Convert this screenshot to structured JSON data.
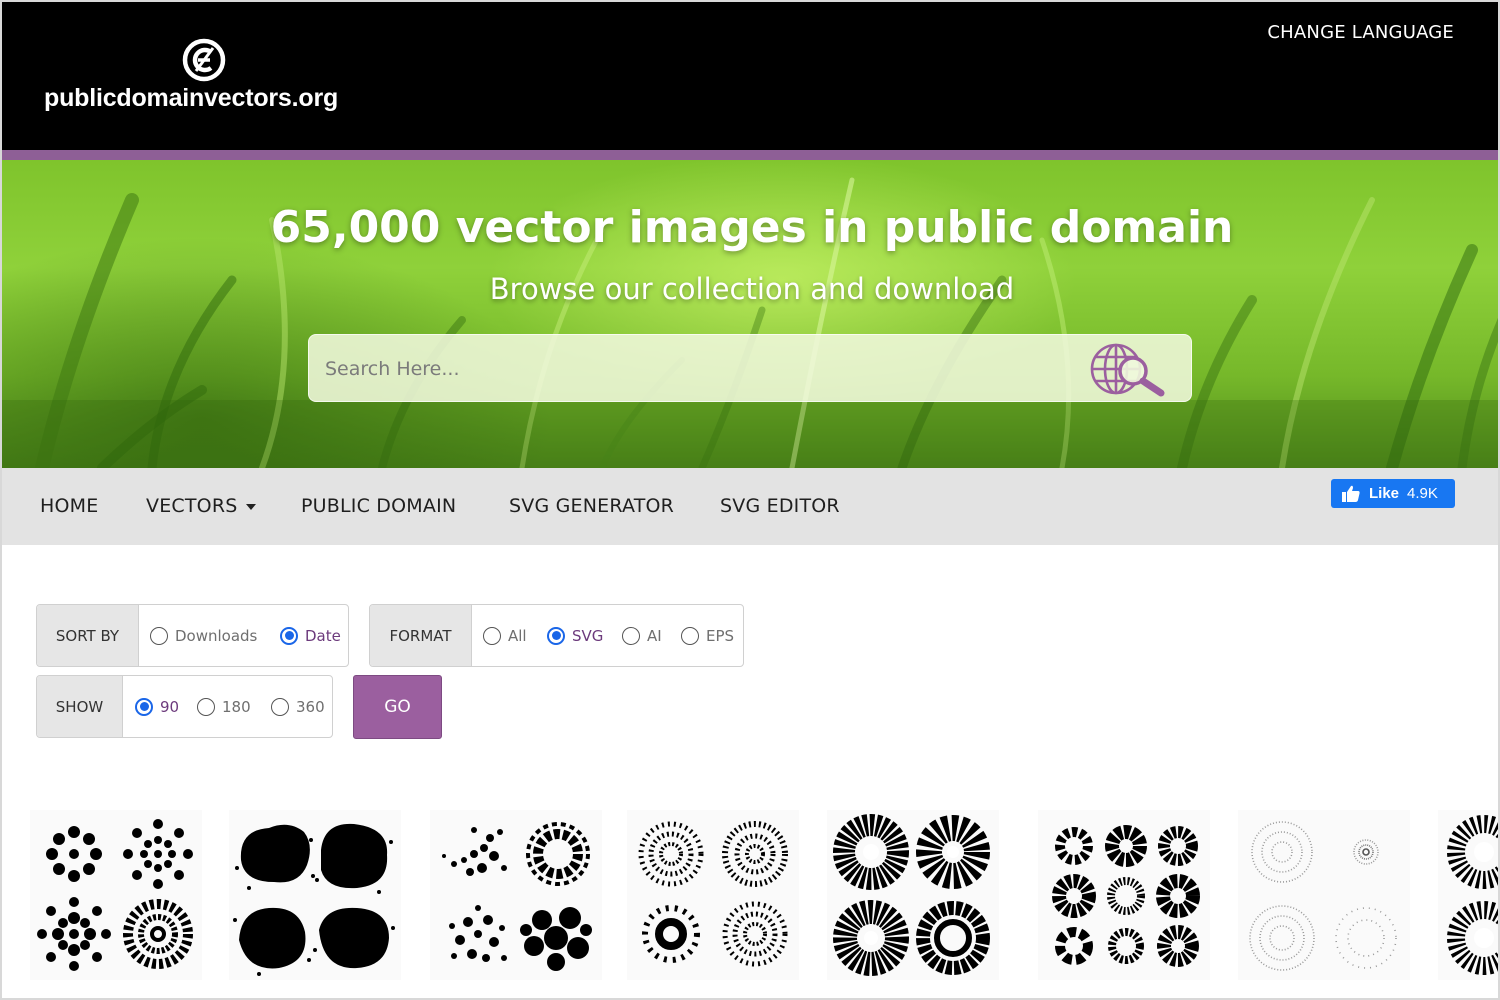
{
  "header": {
    "logo_text": "publicdomainvectors.org",
    "change_language": "CHANGE LANGUAGE"
  },
  "hero": {
    "title": "65,000 vector images in public domain",
    "subtitle": "Browse our collection and download",
    "search_placeholder": "Search Here..."
  },
  "nav": {
    "items": [
      {
        "label": "HOME"
      },
      {
        "label": "VECTORS"
      },
      {
        "label": "PUBLIC DOMAIN"
      },
      {
        "label": "SVG GENERATOR"
      },
      {
        "label": "SVG EDITOR"
      }
    ],
    "fb_like": {
      "label": "Like",
      "count": "4.9K"
    }
  },
  "filters": {
    "sort": {
      "label": "SORT BY",
      "options": [
        {
          "label": "Downloads",
          "selected": false
        },
        {
          "label": "Date",
          "selected": true
        }
      ]
    },
    "format": {
      "label": "FORMAT",
      "options": [
        {
          "label": "All",
          "selected": false
        },
        {
          "label": "SVG",
          "selected": true
        },
        {
          "label": "AI",
          "selected": false
        },
        {
          "label": "EPS",
          "selected": false
        }
      ]
    },
    "show": {
      "label": "SHOW",
      "options": [
        {
          "label": "90",
          "selected": true
        },
        {
          "label": "180",
          "selected": false
        },
        {
          "label": "360",
          "selected": false
        }
      ]
    },
    "go_label": "GO"
  },
  "colors": {
    "accent_purple": "#8e5f96",
    "go_button": "#9b5f9f",
    "radio_selected": "#1a66e8",
    "facebook_blue": "#1877f2",
    "nav_background": "#e3e3e3"
  },
  "thumbnails": [
    {
      "icon": "dotted-circle-patterns"
    },
    {
      "icon": "halftone-blob-patterns"
    },
    {
      "icon": "dot-swirl-patterns"
    },
    {
      "icon": "spiral-dot-patterns"
    },
    {
      "icon": "sunburst-ring-patterns"
    },
    {
      "icon": "swirl-circle-patterns"
    },
    {
      "icon": "faint-dotted-circle-patterns"
    },
    {
      "icon": "radial-stripe-pattern"
    }
  ]
}
